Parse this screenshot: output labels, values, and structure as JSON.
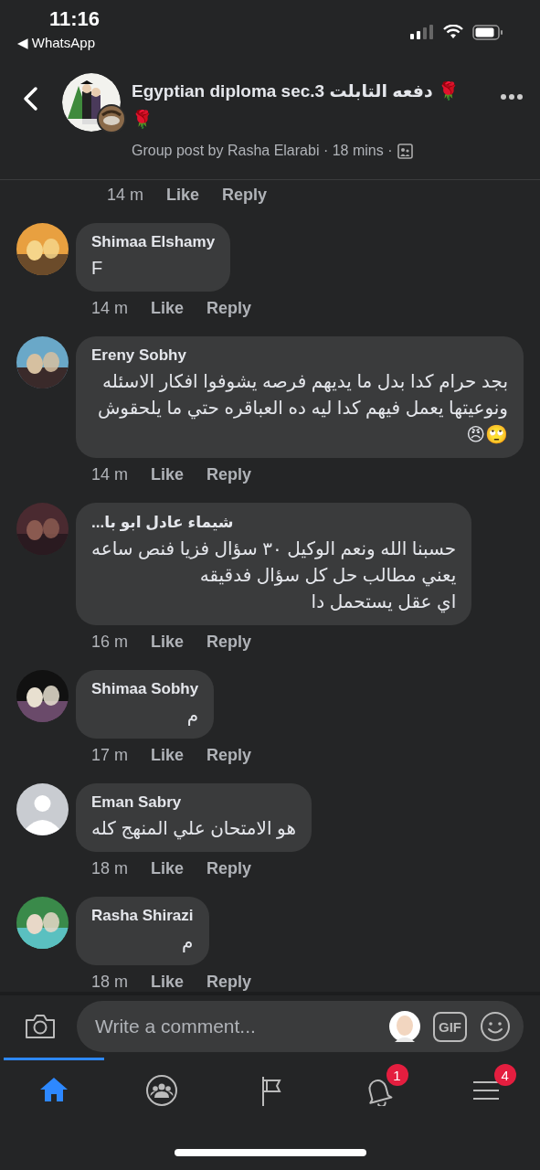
{
  "status_bar": {
    "time": "11:16",
    "back_app": "◀ WhatsApp"
  },
  "header": {
    "title": "Egyptian diploma sec.3 دفعه التابلت 🌹",
    "title_line2": "🌹",
    "subtitle": "Group post by Rasha Elarabi · 18 mins ·"
  },
  "top_meta": {
    "time": "14 m",
    "like": "Like",
    "reply": "Reply"
  },
  "comments": [
    {
      "name": "Shimaa Elshamy",
      "text": "F",
      "time": "14 m",
      "like": "Like",
      "reply": "Reply"
    },
    {
      "name": "Ereny Sobhy",
      "text": "بجد حرام كدا بدل ما يديهم فرصه يشوفوا افكار الاسئله ونوعيتها يعمل فيهم كدا ليه ده العباقره حتي ما يلحقوش🙄😠",
      "time": "14 m",
      "like": "Like",
      "reply": "Reply"
    },
    {
      "name": "شيماء  عادل  ابو با...",
      "text": "حسبنا الله ونعم الوكيل ٣٠ سؤال فزيا فنص ساعه\nيعني مطالب حل كل سؤال فدقيقه\nاي عقل يستحمل دا",
      "time": "16 m",
      "like": "Like",
      "reply": "Reply"
    },
    {
      "name": "Shimaa Sobhy",
      "text": "م",
      "time": "17 m",
      "like": "Like",
      "reply": "Reply"
    },
    {
      "avatar": {
        "kind": "default"
      },
      "name": "Eman Sabry",
      "text": "هو الامتحان علي المنهج كله",
      "time": "18 m",
      "like": "Like",
      "reply": "Reply"
    },
    {
      "name": "Rasha Shirazi",
      "text": "م",
      "time": "18 m",
      "like": "Like",
      "reply": "Reply"
    }
  ],
  "composer": {
    "placeholder": "Write a comment...",
    "gif": "GIF"
  },
  "nav": [
    {
      "kind": "home",
      "selected": true
    },
    {
      "kind": "groups",
      "selected": false
    },
    {
      "kind": "pages",
      "selected": false
    },
    {
      "kind": "notifications",
      "selected": false,
      "badge": "1"
    },
    {
      "kind": "menu",
      "selected": false,
      "badge": "4"
    }
  ]
}
